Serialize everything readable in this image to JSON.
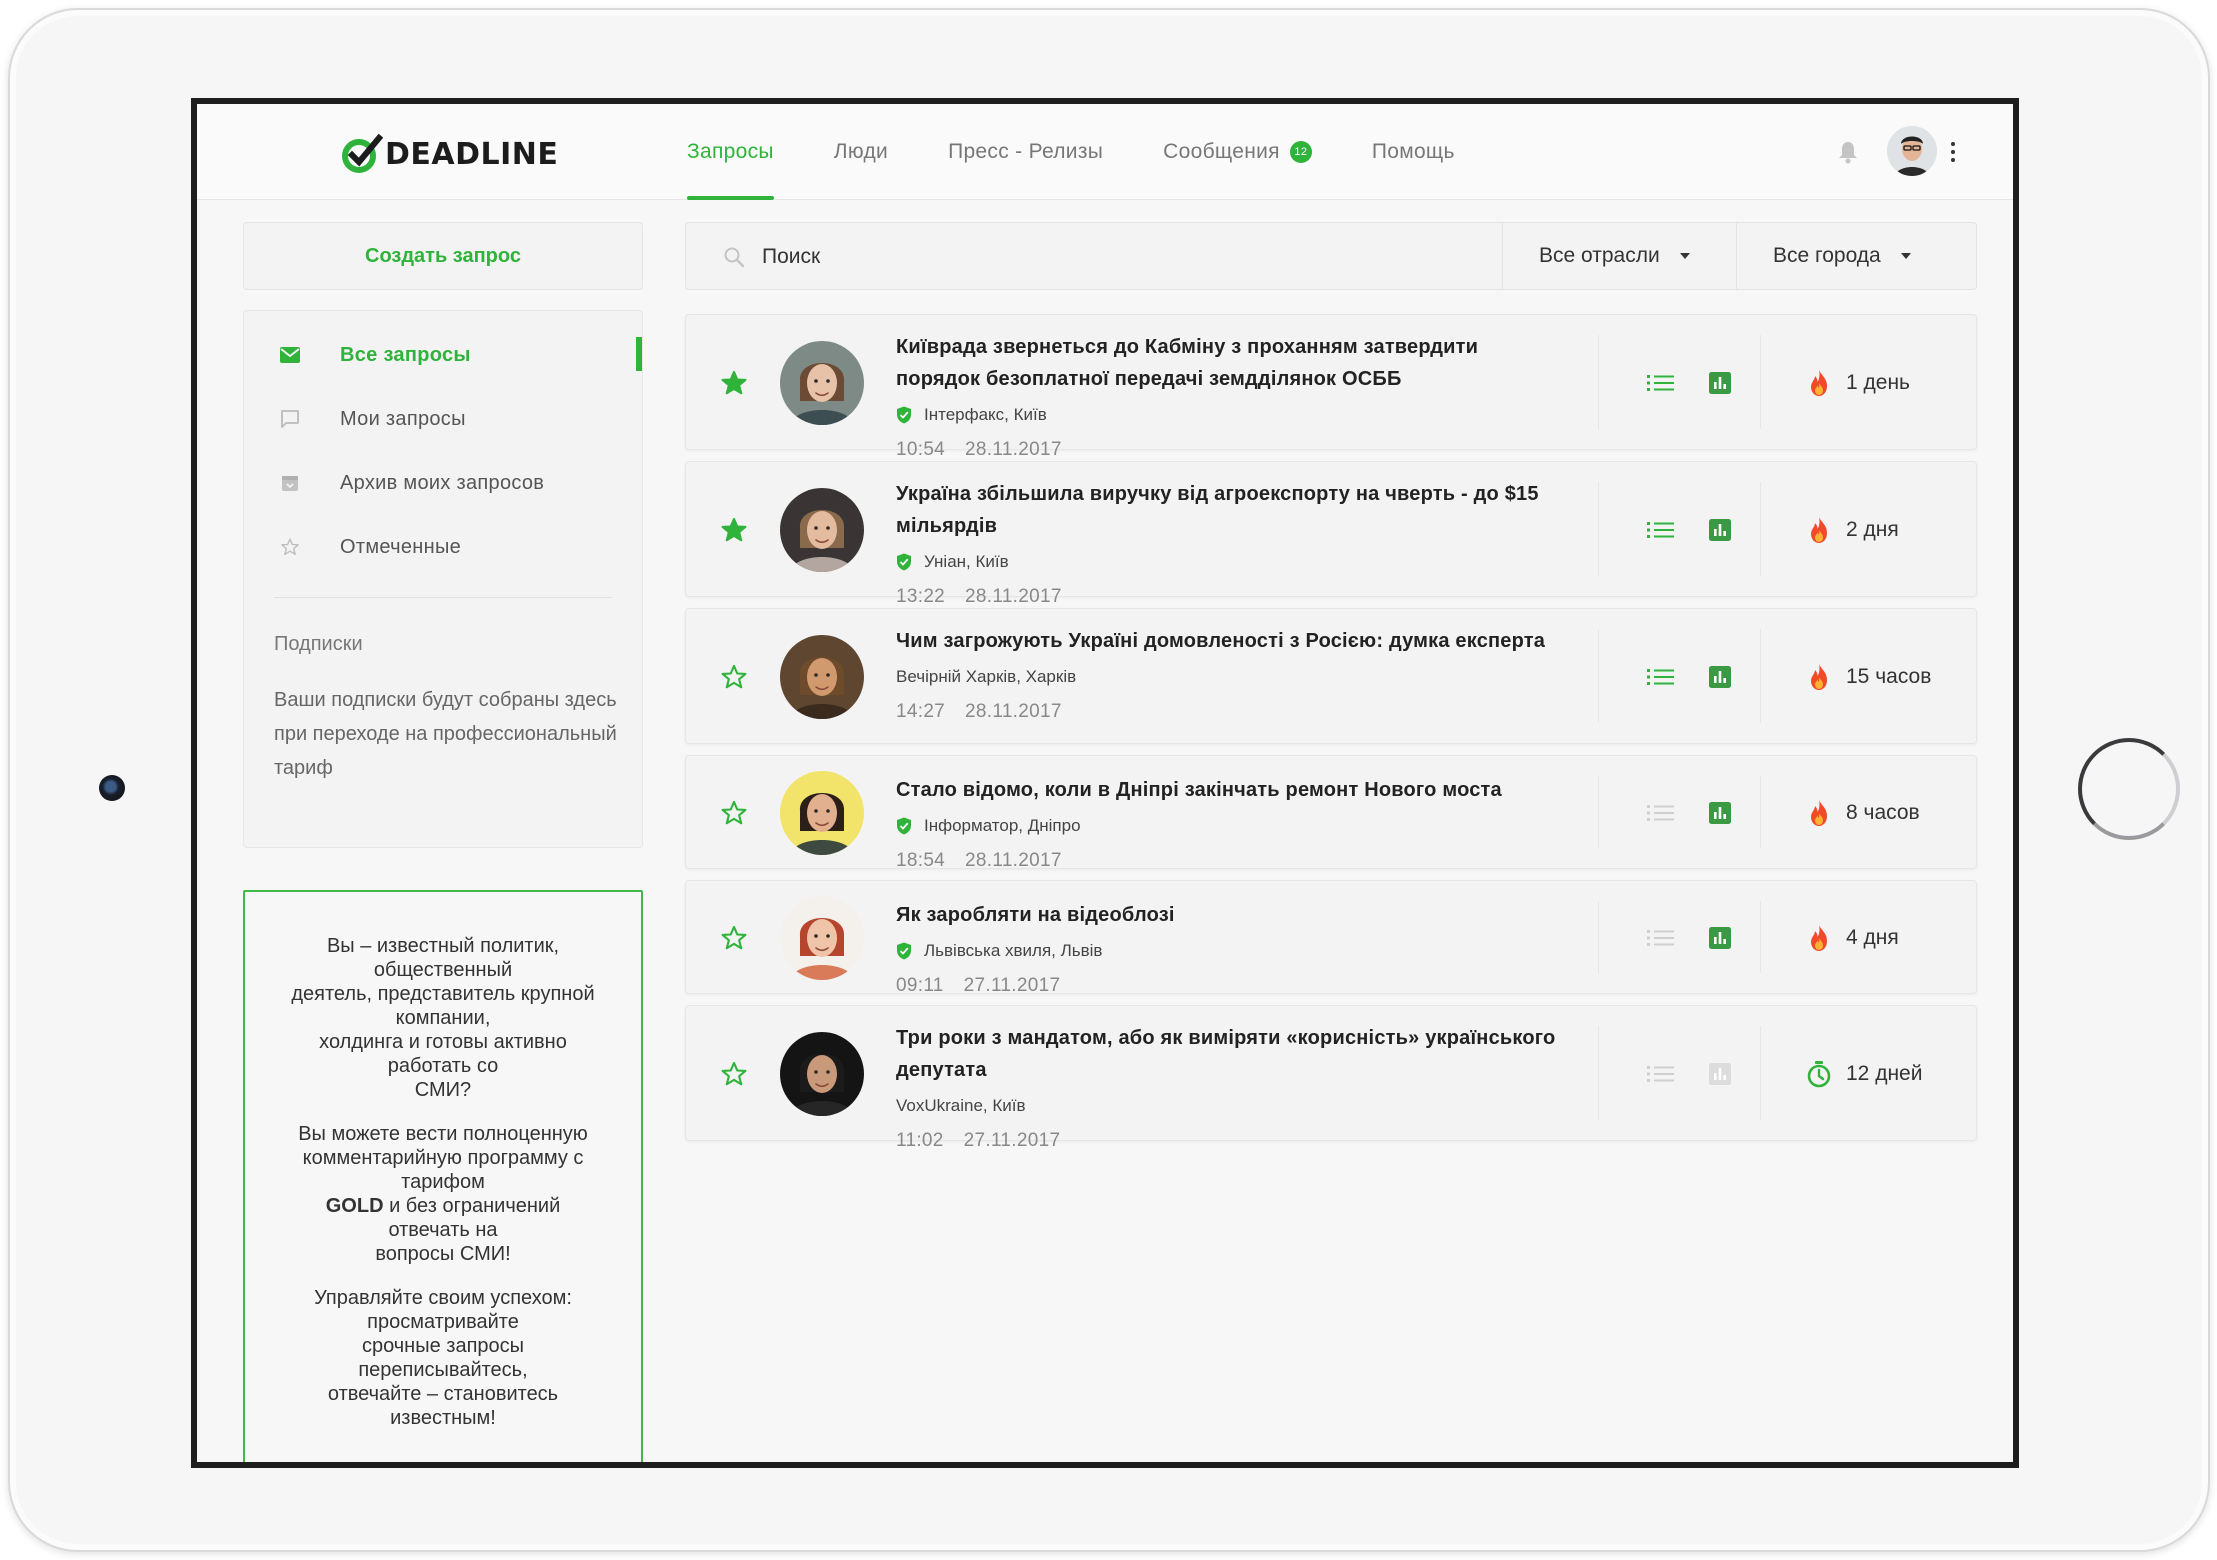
{
  "app": {
    "logo_text": "DEADLINE",
    "accent_color": "#2fb33a"
  },
  "nav": {
    "items": [
      {
        "label": "Запросы",
        "active": true
      },
      {
        "label": "Люди",
        "active": false
      },
      {
        "label": "Пресс - Релизы",
        "active": false
      },
      {
        "label": "Сообщения",
        "active": false,
        "badge": "12"
      },
      {
        "label": "Помощь",
        "active": false
      }
    ],
    "bell_icon": "bell-icon",
    "menu_icon": "kebab-menu-icon"
  },
  "sidebar": {
    "create_button": "Создать запрос",
    "items": [
      {
        "label": "Все запросы",
        "icon": "mail-icon",
        "active": true
      },
      {
        "label": "Мои запросы",
        "icon": "chat-bubble-icon",
        "active": false
      },
      {
        "label": "Архив моих запросов",
        "icon": "archive-icon",
        "active": false
      },
      {
        "label": "Отмеченные",
        "icon": "star-outline-icon",
        "active": false
      }
    ],
    "subscriptions_title": "Подписки",
    "subscriptions_text": "Ваши подписки будут собраны здесь при переходе на профессиональный тариф"
  },
  "promo": {
    "p1": "Вы – известный политик,\nобщественный\nдеятель, представитель крупной\nкомпании,\nхолдинга и готовы активно\nработать со\nСМИ?",
    "p2_before": "Вы можете вести полноценную\nкомментарийную программу с\nтарифом\n",
    "p2_bold": "GOLD",
    "p2_after": " и без ограничений\nотвечать на\nвопросы СМИ!",
    "p3": "Управляйте своим успехом:\nпросматривайте\nсрочные запросы\nпереписывайтесь,\nотвечайте – становитесь\nизвестным!"
  },
  "search": {
    "placeholder": "Поиск",
    "filter_industry": "Все отрасли",
    "filter_city": "Все города"
  },
  "requests": [
    {
      "title": "Київрада звернеться до Кабміну з проханням затвердити порядок безоплатної передачі земдділянок ОСББ",
      "source": "Інтерфакс, Київ",
      "verified": true,
      "time": "10:54",
      "date": "28.11.2017",
      "starred": true,
      "deadline": "1 день",
      "deadline_icon": "fire-icon",
      "list_active": true,
      "chart_active": true
    },
    {
      "title": "Україна збільшила виручку від агроекспорту на чверть - до $15 мільярдів",
      "source": "Уніан, Київ",
      "verified": true,
      "time": "13:22",
      "date": "28.11.2017",
      "starred": true,
      "deadline": "2 дня",
      "deadline_icon": "fire-icon",
      "list_active": true,
      "chart_active": true
    },
    {
      "title": "Чим загрожують Україні домовленості з Росією: думка експерта",
      "source": "Вечірній Харків, Харків",
      "verified": false,
      "time": "14:27",
      "date": "28.11.2017",
      "starred": false,
      "deadline": "15 часов",
      "deadline_icon": "fire-icon",
      "list_active": true,
      "chart_active": true
    },
    {
      "title": "Стало відомо, коли в Дніпрі закінчать ремонт Нового моста",
      "source": "Інформатор, Дніпро",
      "verified": true,
      "time": "18:54",
      "date": "28.11.2017",
      "starred": false,
      "deadline": "8 часов",
      "deadline_icon": "fire-icon",
      "list_active": false,
      "chart_active": true
    },
    {
      "title": "Як заробляти на відеоблозі",
      "source": "Львівська хвиля, Львів",
      "verified": true,
      "time": "09:11",
      "date": "27.11.2017",
      "starred": false,
      "deadline": "4 дня",
      "deadline_icon": "fire-icon",
      "list_active": false,
      "chart_active": true
    },
    {
      "title": "Три роки з мандатом, або як виміряти «корисність» українського депутата",
      "source": "VoxUkraine, Київ",
      "verified": false,
      "time": "11:02",
      "date": "27.11.2017",
      "starred": false,
      "deadline": "12 дней",
      "deadline_icon": "stopwatch-icon",
      "list_active": false,
      "chart_active": false
    }
  ]
}
